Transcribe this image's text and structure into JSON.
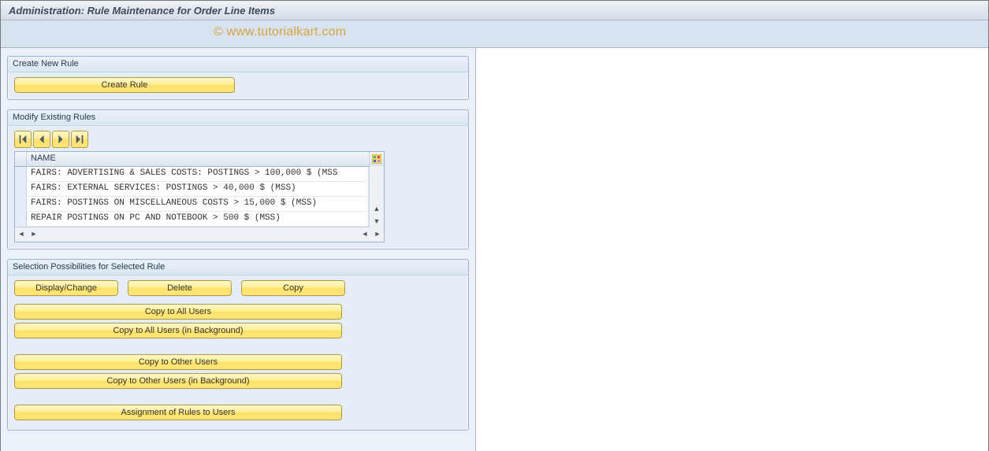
{
  "title": "Administration: Rule Maintenance for Order Line Items",
  "watermark": "© www.tutorialkart.com",
  "panels": {
    "create": {
      "title": "Create New Rule",
      "create_btn": "Create Rule"
    },
    "modify": {
      "title": "Modify Existing Rules",
      "table": {
        "header": "NAME",
        "rows": [
          "FAIRS: ADVERTISING & SALES COSTS: POSTINGS > 100,000 $ (MSS",
          "FAIRS: EXTERNAL SERVICES: POSTINGS > 40,000 $ (MSS)",
          "FAIRS: POSTINGS ON MISCELLANEOUS COSTS > 15,000 $ (MSS)",
          "REPAIR POSTINGS ON PC AND NOTEBOOK > 500 $ (MSS)"
        ]
      }
    },
    "selection": {
      "title": "Selection Possibilities for Selected Rule",
      "display_change": "Display/Change",
      "delete": "Delete",
      "copy": "Copy",
      "copy_all": "Copy to All Users",
      "copy_all_bg": "Copy to All Users (in Background)",
      "copy_other": "Copy to Other Users",
      "copy_other_bg": "Copy to Other Users (in Background)",
      "assign": "Assignment of Rules to Users"
    }
  }
}
